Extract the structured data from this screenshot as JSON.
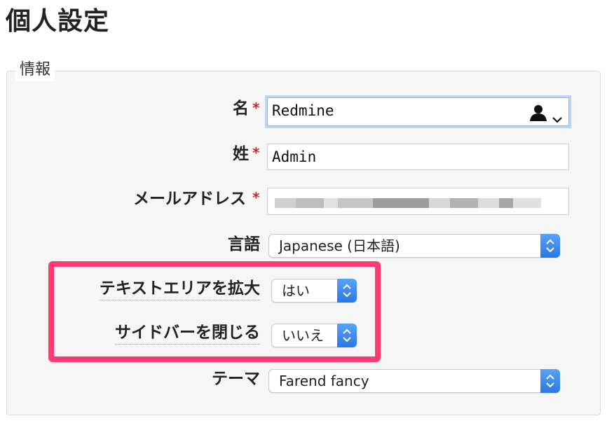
{
  "page": {
    "title": "個人設定"
  },
  "section": {
    "legend": "情報"
  },
  "fields": {
    "firstname": {
      "label": "名",
      "value": "Redmine",
      "required_mark": "*"
    },
    "lastname": {
      "label": "姓",
      "value": "Admin",
      "required_mark": "*"
    },
    "email": {
      "label": "メールアドレス",
      "required_mark": "*"
    },
    "language": {
      "label": "言語",
      "value": "Japanese (日本語)"
    },
    "textarea_expand": {
      "label": "テキストエリアを拡大",
      "value": "はい"
    },
    "sidebar_close": {
      "label": "サイドバーを閉じる",
      "value": "いいえ"
    },
    "theme": {
      "label": "テーマ",
      "value": "Farend fancy"
    }
  },
  "icons": {
    "contact_autofill": "person-silhouette-icon",
    "dropdown": "chevron-down-icon",
    "select_stepper": "up-down-arrows-icon"
  },
  "colors": {
    "highlight_border": "#ff3b72",
    "required_asterisk": "#e02020",
    "focus_ring": "#b9d6f6",
    "select_button": "#2a78e4"
  }
}
